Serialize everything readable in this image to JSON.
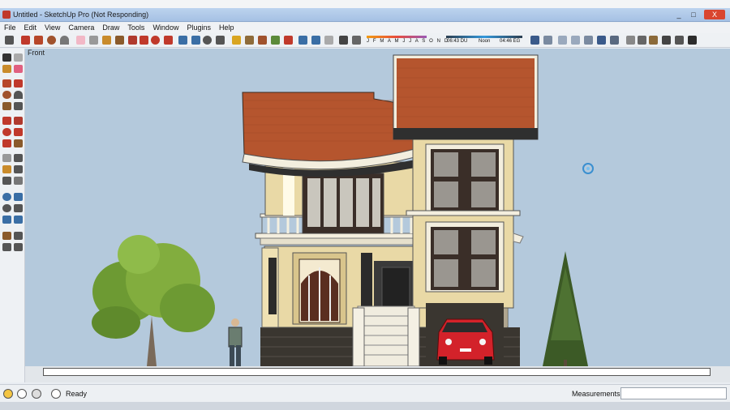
{
  "window": {
    "title": "Untitled - SketchUp Pro (Not Responding)",
    "min_label": "_",
    "max_label": "□",
    "close_label": "X"
  },
  "menu": [
    "File",
    "Edit",
    "View",
    "Camera",
    "Draw",
    "Tools",
    "Window",
    "Plugins",
    "Help"
  ],
  "shadow": {
    "months": "J F M A M J J A S O N D",
    "time_start": "06:43 DU",
    "noon": "Noon",
    "time_end": "04:46 EG"
  },
  "viewport": {
    "scene_label": "Front",
    "colors": {
      "sky": "#b4c9dc",
      "roof": "#b5552e",
      "wall": "#e9d9a6",
      "base": "#3a3630",
      "car": "#d3222a"
    }
  },
  "status": {
    "text": "Ready",
    "measurements_label": "Measurements",
    "measurements_value": ""
  },
  "icons": [
    "select-icon",
    "pencil-icon",
    "rectangle-icon",
    "circle-icon",
    "arc-icon",
    "eraser-icon",
    "paint-bucket-icon",
    "push-pull-icon",
    "move-icon",
    "rotate-icon",
    "scale-icon",
    "offset-icon",
    "tape-measure-icon",
    "protractor-icon",
    "text-icon",
    "orbit-icon",
    "pan-icon",
    "zoom-icon",
    "zoom-extents-icon",
    "walk-icon",
    "look-around-icon",
    "section-plane-icon",
    "help-icon",
    "geo-location-icon",
    "credits-icon"
  ]
}
